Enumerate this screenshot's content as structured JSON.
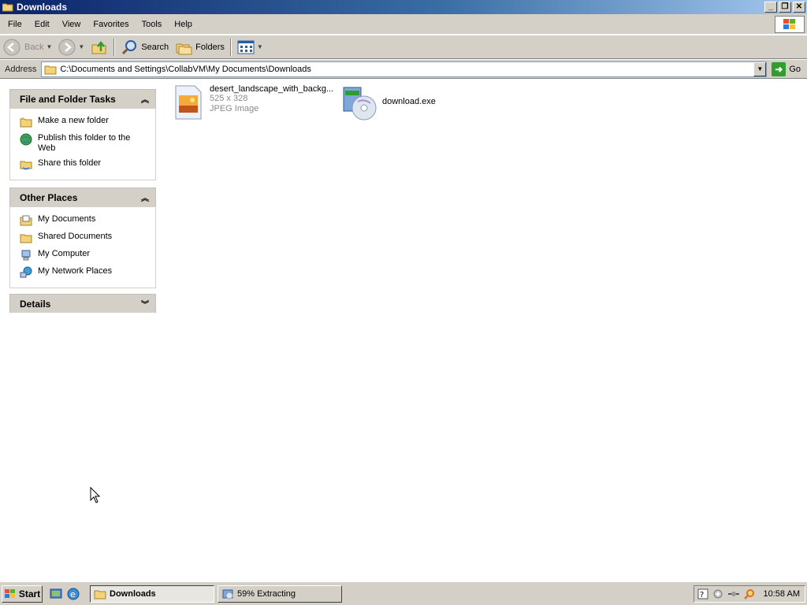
{
  "window": {
    "title": "Downloads"
  },
  "menu": [
    "File",
    "Edit",
    "View",
    "Favorites",
    "Tools",
    "Help"
  ],
  "toolbar": {
    "back": "Back",
    "search": "Search",
    "folders": "Folders"
  },
  "address": {
    "label": "Address",
    "path": "C:\\Documents and Settings\\CollabVM\\My Documents\\Downloads",
    "go": "Go"
  },
  "tasks_panel": {
    "title": "File and Folder Tasks",
    "items": [
      "Make a new folder",
      "Publish this folder to the Web",
      "Share this folder"
    ]
  },
  "places_panel": {
    "title": "Other Places",
    "items": [
      "My Documents",
      "Shared Documents",
      "My Computer",
      "My Network Places"
    ]
  },
  "details_panel": {
    "title": "Details"
  },
  "files": [
    {
      "name": "desert_landscape_with_backg...",
      "dims": "525 x 328",
      "type": "JPEG Image",
      "icon": "jpeg-image-icon"
    },
    {
      "name": "download.exe",
      "icon": "installer-cd-icon"
    }
  ],
  "taskbar": {
    "start": "Start",
    "tasks": [
      "Downloads",
      "59% Extracting"
    ],
    "clock": "10:58 AM"
  }
}
